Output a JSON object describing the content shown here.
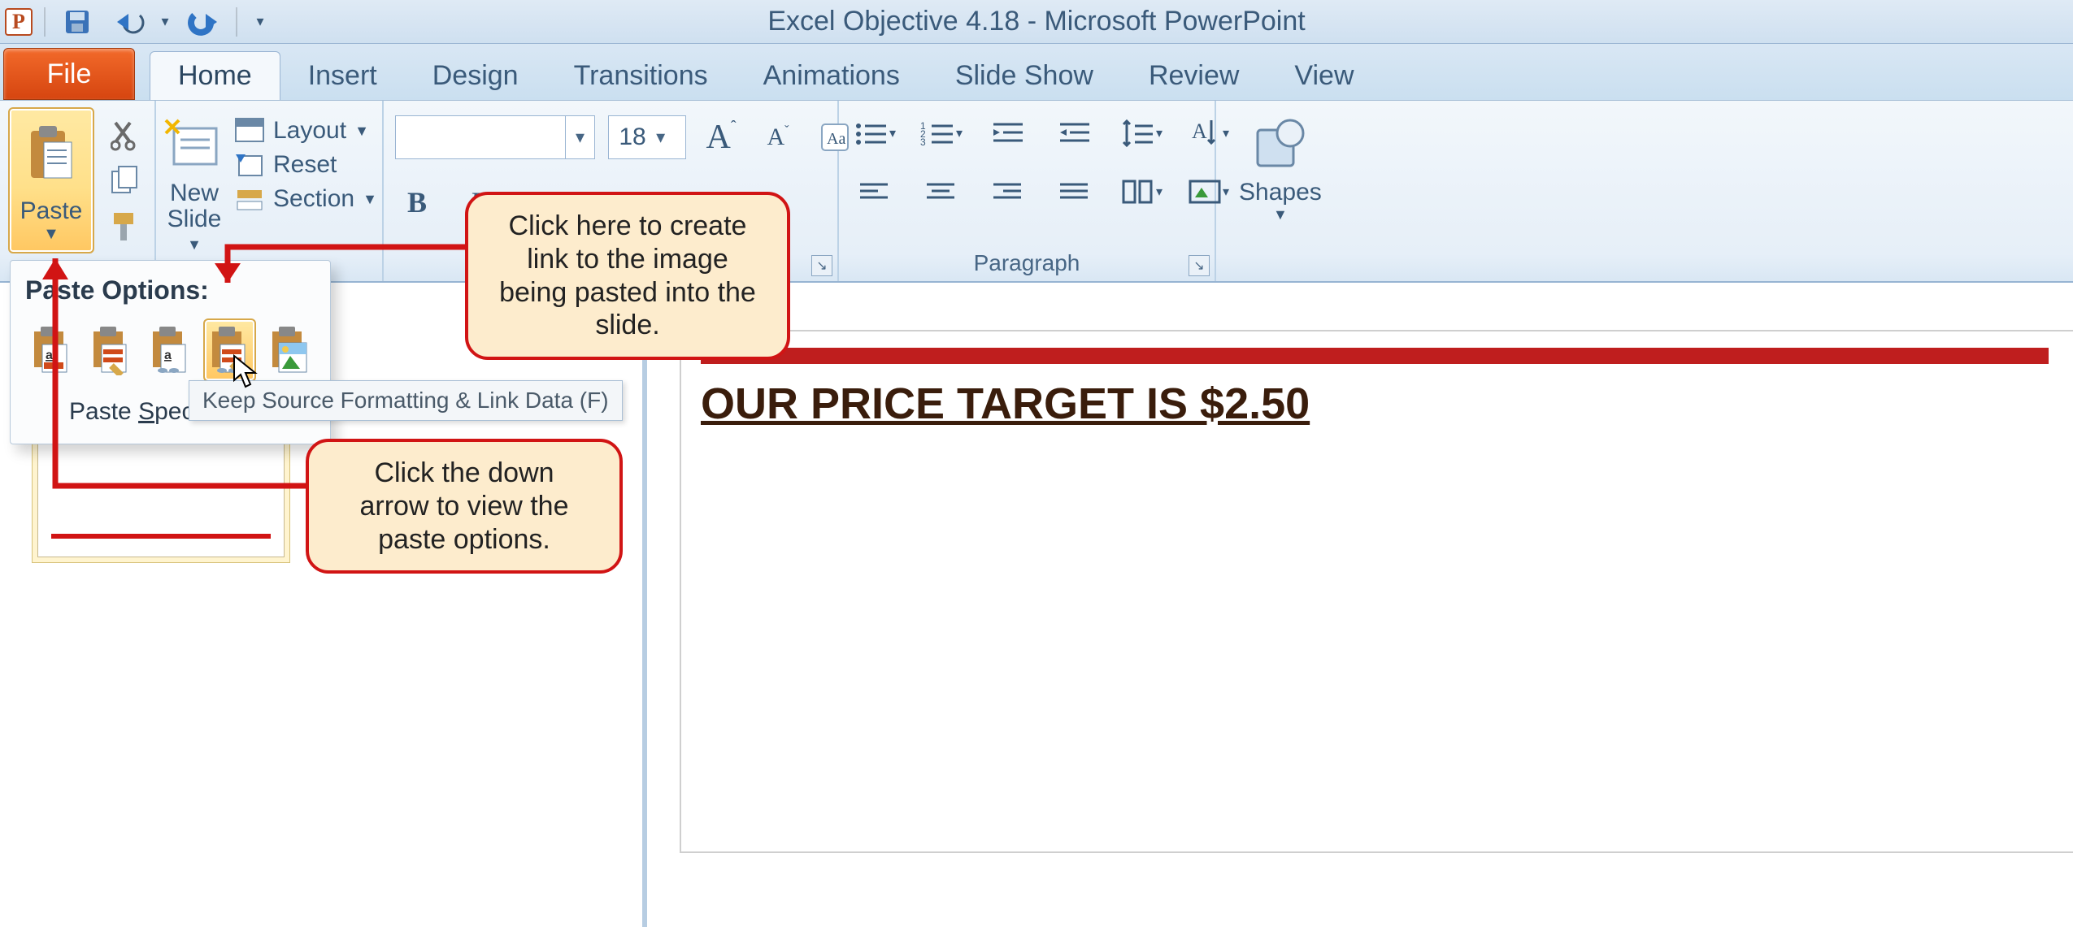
{
  "window": {
    "title": "Excel Objective 4.18  -  Microsoft PowerPoint"
  },
  "tabs": {
    "file": "File",
    "list": [
      "Home",
      "Insert",
      "Design",
      "Transitions",
      "Animations",
      "Slide Show",
      "Review",
      "View"
    ],
    "active": "Home"
  },
  "clipboard": {
    "paste": "Paste"
  },
  "slides": {
    "new": "New\nSlide",
    "layout": "Layout",
    "reset": "Reset",
    "section": "Section"
  },
  "font": {
    "size": "18",
    "bold": "B",
    "italic": "I"
  },
  "paragraph": {
    "label": "Paragraph"
  },
  "drawing": {
    "shapes": "Shapes"
  },
  "paste_options": {
    "title": "Paste Options:",
    "special": "Paste Special...",
    "tooltip": "Keep Source Formatting & Link Data (F)"
  },
  "callouts": {
    "top": "Click here to create link to the image being pasted into the slide.",
    "bottom": "Click the down arrow to view the paste options."
  },
  "slide": {
    "title": "OUR PRICE TARGET IS $2.50"
  }
}
